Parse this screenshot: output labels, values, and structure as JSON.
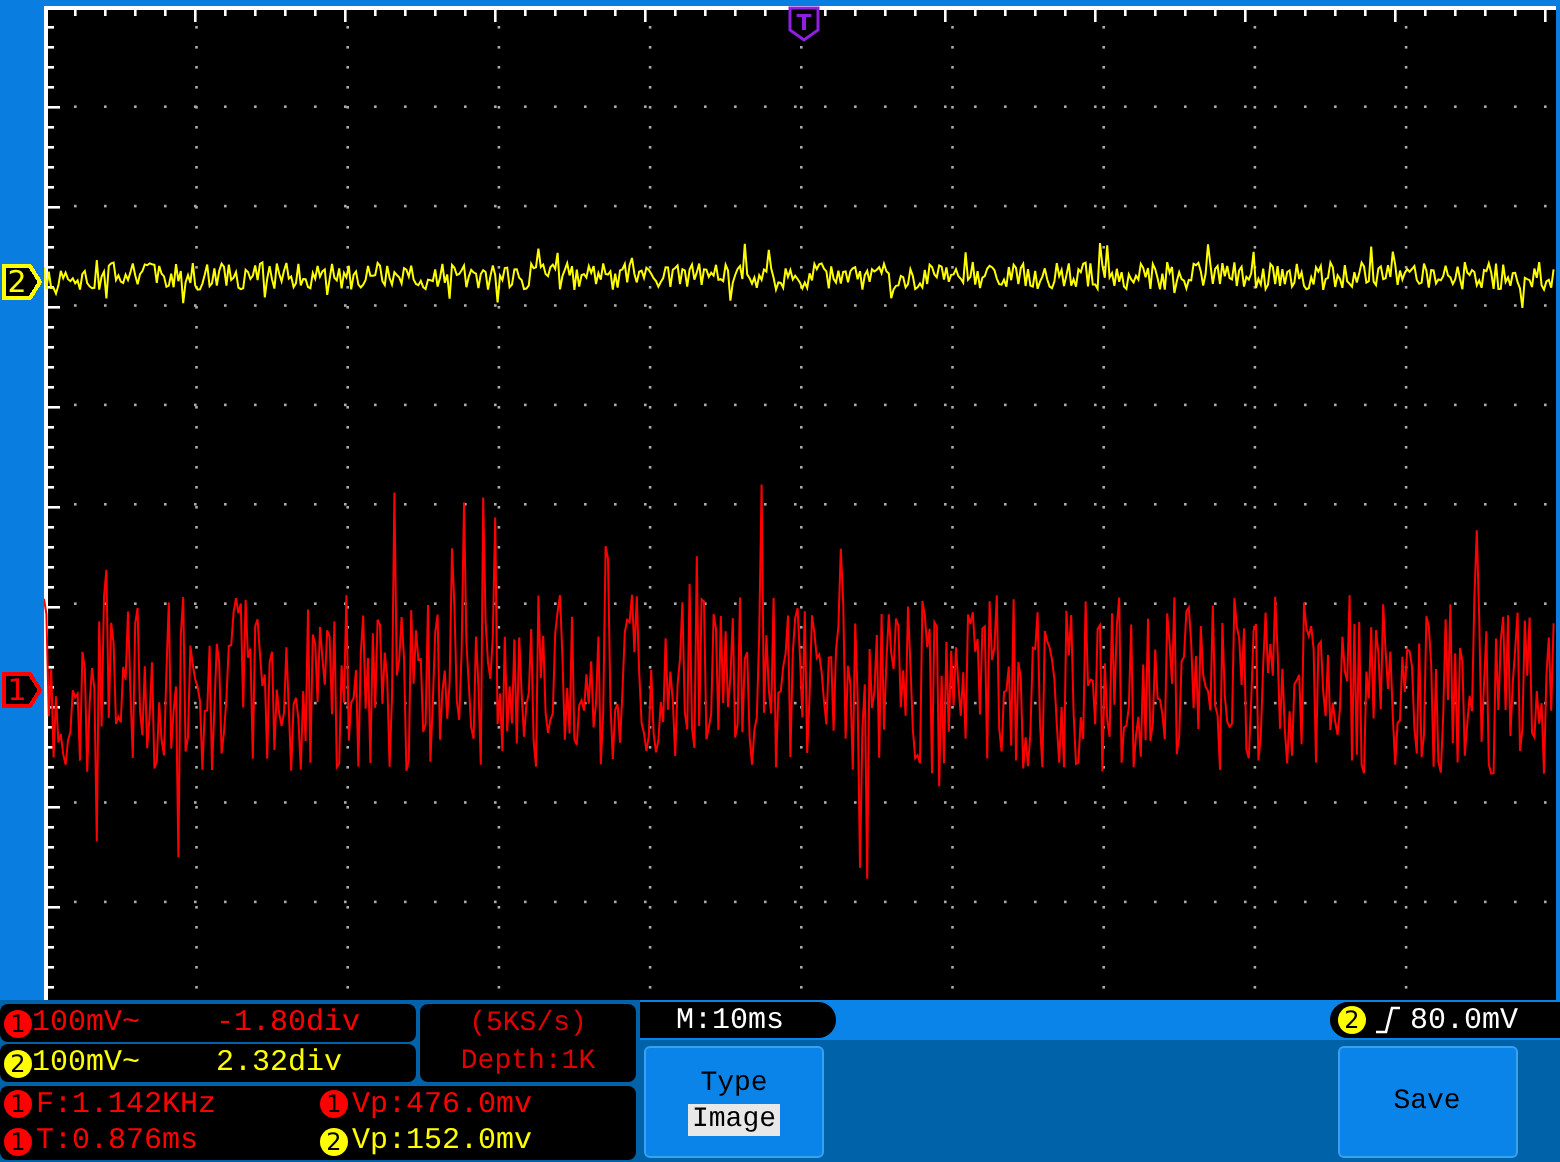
{
  "screen": {
    "trigger_position_marker": "T",
    "channel_markers": [
      {
        "label": "2",
        "color": "#ffff00",
        "kind": "ch2"
      },
      {
        "label": "1",
        "color": "#ff0000",
        "kind": "ch1"
      }
    ]
  },
  "channels": [
    {
      "badge": "1",
      "color": "#ff0000",
      "scale": "100mV~",
      "offset": "-1.80div"
    },
    {
      "badge": "2",
      "color": "#ffff00",
      "scale": "100mV~",
      "offset": "2.32div"
    }
  ],
  "acquisition": {
    "sample_rate": "(5KS/s)",
    "depth": "Depth:1K"
  },
  "measurements": [
    {
      "badge": "1",
      "color": "#ff0000",
      "text": "F:1.142KHz"
    },
    {
      "badge": "1",
      "color": "#ff0000",
      "text": "Vp:476.0mv"
    },
    {
      "badge": "1",
      "color": "#ff0000",
      "text": "T:0.876ms"
    },
    {
      "badge": "2",
      "color": "#ffff00",
      "text": "Vp:152.0mv"
    }
  ],
  "timebase": "M:10ms",
  "trigger": {
    "badge": "2",
    "color": "#ffff00",
    "level": "80.0mV"
  },
  "softkeys": [
    {
      "kind": "select",
      "label": "Type",
      "value": "Image"
    },
    {
      "kind": "spacer"
    },
    {
      "kind": "spacer"
    },
    {
      "kind": "action",
      "label": "Save"
    }
  ]
}
